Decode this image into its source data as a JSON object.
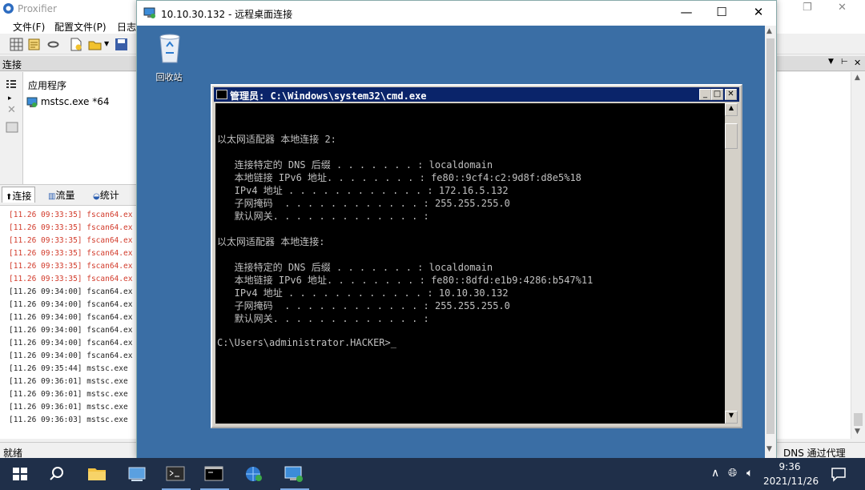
{
  "proxifier": {
    "title": "Proxifier",
    "menu": [
      "文件(F)",
      "配置文件(P)",
      "日志"
    ],
    "connections_header": "连接",
    "apps_header": "应用程序",
    "app_row": "mstsc.exe *64",
    "tabs": [
      "连接",
      "流量",
      "统计"
    ],
    "log": [
      {
        "text": "[11.26 09:33:35] fscan64.ex",
        "color": "red"
      },
      {
        "text": "[11.26 09:33:35] fscan64.ex",
        "color": "red"
      },
      {
        "text": "[11.26 09:33:35] fscan64.ex",
        "color": "red"
      },
      {
        "text": "[11.26 09:33:35] fscan64.ex",
        "color": "red"
      },
      {
        "text": "[11.26 09:33:35] fscan64.ex",
        "color": "red"
      },
      {
        "text": "[11.26 09:33:35] fscan64.ex",
        "color": "red"
      },
      {
        "text": "[11.26 09:34:00] fscan64.ex",
        "color": "dark"
      },
      {
        "text": "[11.26 09:34:00] fscan64.ex",
        "color": "dark"
      },
      {
        "text": "[11.26 09:34:00] fscan64.ex",
        "color": "dark"
      },
      {
        "text": "[11.26 09:34:00] fscan64.ex",
        "color": "dark"
      },
      {
        "text": "[11.26 09:34:00] fscan64.ex",
        "color": "dark"
      },
      {
        "text": "[11.26 09:34:00] fscan64.ex",
        "color": "dark"
      },
      {
        "text": "[11.26 09:35:44] mstsc.exe",
        "color": "dark"
      },
      {
        "text": "[11.26 09:36:01] mstsc.exe",
        "color": "dark"
      },
      {
        "text": "[11.26 09:36:01] mstsc.exe",
        "color": "dark"
      },
      {
        "text": "[11.26 09:36:01] mstsc.exe",
        "color": "dark"
      },
      {
        "text": "[11.26 09:36:03] mstsc.exe",
        "color": "dark"
      }
    ],
    "status_left": "就绪",
    "status_right": "DNS 通过代理"
  },
  "rdp": {
    "title": "10.10.30.132 - 远程桌面连接",
    "recycle_bin_label": "回收站"
  },
  "cmd": {
    "title": "管理员: C:\\Windows\\system32\\cmd.exe",
    "lines": [
      "",
      "以太网适配器 本地连接 2:",
      "",
      "   连接特定的 DNS 后缀 . . . . . . . : localdomain",
      "   本地链接 IPv6 地址. . . . . . . . : fe80::9cf4:c2:9d8f:d8e5%18",
      "   IPv4 地址 . . . . . . . . . . . . : 172.16.5.132",
      "   子网掩码  . . . . . . . . . . . . : 255.255.255.0",
      "   默认网关. . . . . . . . . . . . . :",
      "",
      "以太网适配器 本地连接:",
      "",
      "   连接特定的 DNS 后缀 . . . . . . . : localdomain",
      "   本地链接 IPv6 地址. . . . . . . . : fe80::8dfd:e1b9:4286:b547%11",
      "   IPv4 地址 . . . . . . . . . . . . : 10.10.30.132",
      "   子网掩码  . . . . . . . . . . . . : 255.255.255.0",
      "   默认网关. . . . . . . . . . . . . :",
      "",
      "C:\\Users\\administrator.HACKER>_"
    ]
  },
  "taskbar": {
    "time": "9:36",
    "date": "2021/11/26",
    "icons": [
      "windows-start-icon",
      "search-icon",
      "file-explorer-icon",
      "server-manager-icon",
      "powershell-icon",
      "cmd-icon",
      "network-icon",
      "remote-desktop-icon"
    ]
  },
  "colors": {
    "desktop_blue": "#3a6ea5",
    "cmd_title_blue": "#0a246a",
    "log_red": "#d23b2b",
    "taskbar": "#1f2f49"
  }
}
